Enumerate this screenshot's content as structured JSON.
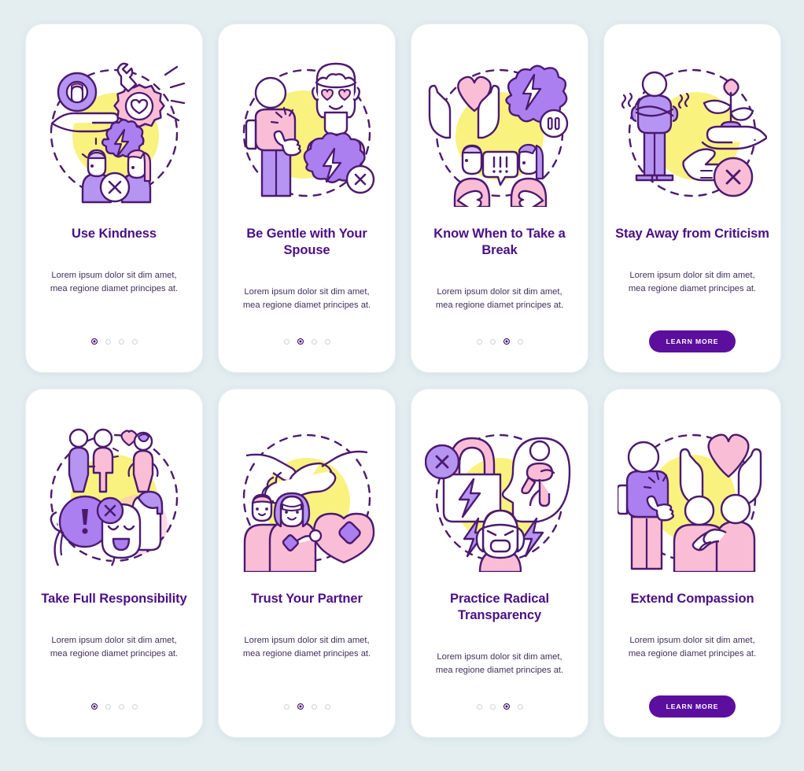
{
  "background_color": "#e4eef1",
  "palette": {
    "card": "#ffffff",
    "title": "#4b0f86",
    "body_text": "#42305a",
    "button": "#5c0f9e",
    "button_label": "#ffffff",
    "dot_active": "#3b0a6e",
    "dot_inactive": "#cfd3d8",
    "outline": "#4b1a6f",
    "purple": "#a98bf0",
    "pink": "#f9bdd6",
    "yellow": "#f7ef86"
  },
  "shared": {
    "description": "Lorem ipsum dolor sit dim amet, mea regione diamet principes at.",
    "cta_label": "LEARN MORE"
  },
  "screens": [
    {
      "id": "use-kindness",
      "title": "Use Kindness",
      "description": "Lorem ipsum dolor sit dim amet, mea regione diamet principes at.",
      "footer_type": "dots",
      "dots_total": 4,
      "dots_active_index": 0,
      "illustration": "kindness-hand-gear-heart-icon"
    },
    {
      "id": "be-gentle-with-your-spouse",
      "title": "Be Gentle with Your Spouse",
      "description": "Lorem ipsum dolor sit dim amet, mea regione diamet principes at.",
      "footer_type": "dots",
      "dots_total": 4,
      "dots_active_index": 1,
      "illustration": "couple-heart-eyes-anger-cloud-icon"
    },
    {
      "id": "know-when-to-take-a-break",
      "title": "Know When to Take a Break",
      "description": "Lorem ipsum dolor sit dim amet, mea regione diamet principes at.",
      "footer_type": "dots",
      "dots_total": 4,
      "dots_active_index": 2,
      "illustration": "hands-heart-pause-argument-icon"
    },
    {
      "id": "stay-away-from-criticism",
      "title": "Stay Away from Criticism",
      "description": "Lorem ipsum dolor sit dim amet, mea regione diamet principes at.",
      "footer_type": "button",
      "cta_label": "LEARN MORE",
      "illustration": "crossed-arms-plant-pointing-finger-icon"
    },
    {
      "id": "take-full-responsibility",
      "title": "Take Full Responsibility",
      "description": "Lorem ipsum dolor sit dim amet, mea regione diamet principes at.",
      "footer_type": "dots",
      "dots_total": 4,
      "dots_active_index": 0,
      "illustration": "family-exclamation-mask-icon"
    },
    {
      "id": "trust-your-partner",
      "title": "Trust Your Partner",
      "description": "Lorem ipsum dolor sit dim amet, mea regione diamet principes at.",
      "footer_type": "dots",
      "dots_total": 4,
      "dots_active_index": 1,
      "illustration": "handshake-couple-bandaged-heart-icon"
    },
    {
      "id": "practice-radical-transparency",
      "title": "Practice Radical Transparency",
      "description": "Lorem ipsum dolor sit dim amet, mea regione diamet principes at.",
      "footer_type": "dots",
      "dots_total": 4,
      "dots_active_index": 2,
      "illustration": "lock-head-yoga-lightning-icon"
    },
    {
      "id": "extend-compassion",
      "title": "Extend Compassion",
      "description": "Lorem ipsum dolor sit dim amet, mea regione diamet principes at.",
      "footer_type": "button",
      "cta_label": "LEARN MORE",
      "illustration": "hands-heart-hug-comfort-icon"
    }
  ]
}
